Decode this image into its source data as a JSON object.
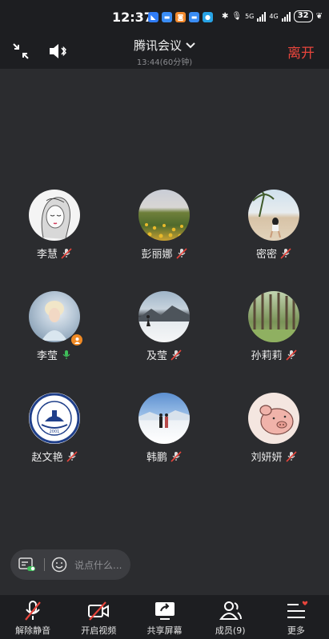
{
  "status_bar": {
    "time": "12:37",
    "signal1_label": "5G",
    "signal2_label": "4G",
    "battery": "32"
  },
  "header": {
    "title": "腾讯会议",
    "subtitle": "13:44(60分钟)",
    "leave_label": "离开"
  },
  "participants": [
    {
      "name": "李慧",
      "mic": "muted"
    },
    {
      "name": "彭丽娜",
      "mic": "muted"
    },
    {
      "name": "密密",
      "mic": "muted"
    },
    {
      "name": "李莹",
      "mic": "on",
      "host": true
    },
    {
      "name": "及莹",
      "mic": "muted"
    },
    {
      "name": "孙莉莉",
      "mic": "muted"
    },
    {
      "name": "赵文艳",
      "mic": "muted"
    },
    {
      "name": "韩鹏",
      "mic": "muted"
    },
    {
      "name": "刘妍妍",
      "mic": "muted"
    }
  ],
  "chat": {
    "placeholder": "说点什么..."
  },
  "toolbar": {
    "unmute_label": "解除静音",
    "video_label": "开启视频",
    "share_label": "共享屏幕",
    "members_label": "成员(9)",
    "more_label": "更多"
  },
  "colors": {
    "background": "#2b2c2f",
    "bar": "#1d1e21",
    "leave": "#e8453c",
    "muted": "#e8453c",
    "mic_on": "#3fbf5a",
    "host": "#f08a24"
  }
}
